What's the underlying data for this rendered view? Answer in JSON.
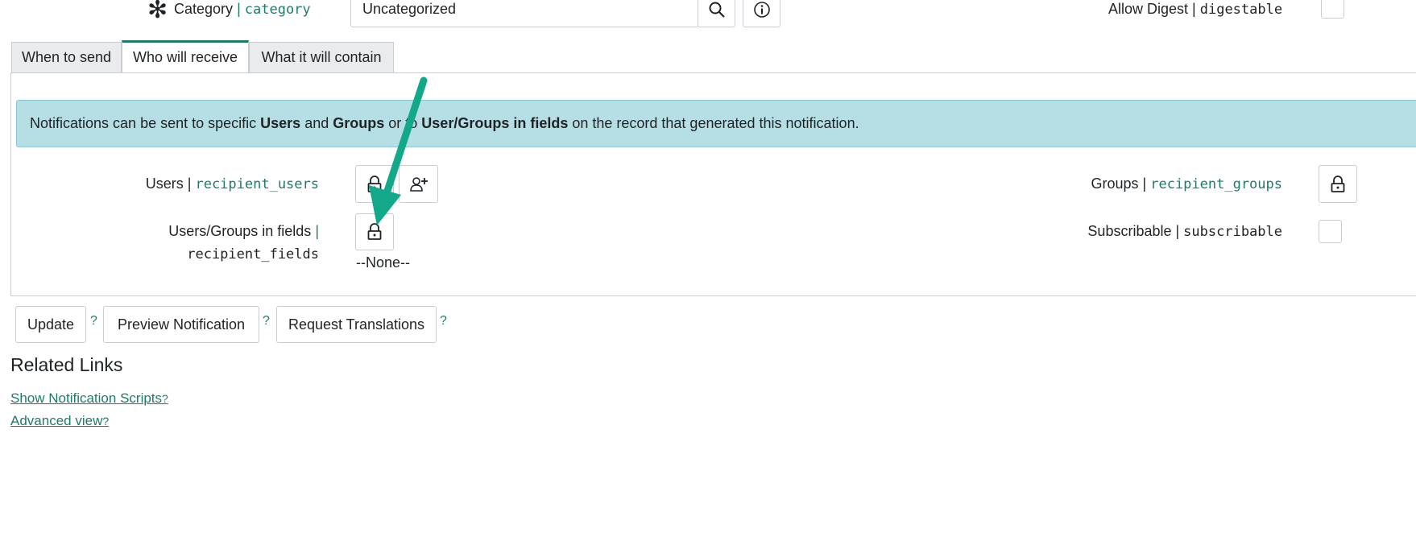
{
  "top": {
    "required_icon": "asterisk-icon",
    "category_label": "Category",
    "category_field": "category",
    "category_value": "Uncategorized",
    "allow_digest_label": "Allow Digest",
    "allow_digest_field": "digestable",
    "search_icon": "search-icon",
    "info_icon": "info-icon"
  },
  "tabs": [
    {
      "label": "When to send"
    },
    {
      "label": "Who will receive"
    },
    {
      "label": "What it will contain"
    }
  ],
  "info_banner": {
    "t1": "Notifications can be sent to specific ",
    "b1": "Users",
    "t2": " and ",
    "b2": "Groups",
    "t3": " or to ",
    "b3": "User/Groups in fields",
    "t4": " on the record that generated this notification."
  },
  "fields": {
    "users_label": "Users",
    "users_field": "recipient_users",
    "fields_label": "Users/Groups in fields",
    "fields_field": "recipient_fields",
    "fields_value": "--None--",
    "groups_label": "Groups",
    "groups_field": "recipient_groups",
    "subscribable_label": "Subscribable",
    "subscribable_field": "subscribable",
    "lock_icon": "lock-icon",
    "add_user_icon": "add-user-icon"
  },
  "actions": {
    "update": "Update",
    "preview": "Preview Notification",
    "translations": "Request Translations",
    "help": "?"
  },
  "related": {
    "title": "Related Links",
    "show_scripts": "Show Notification Scripts",
    "advanced_view": "Advanced view",
    "help": "?"
  },
  "colors": {
    "accent": "#1f7a6a",
    "banner_bg": "#b5dfe5",
    "arrow": "#14a88a"
  }
}
